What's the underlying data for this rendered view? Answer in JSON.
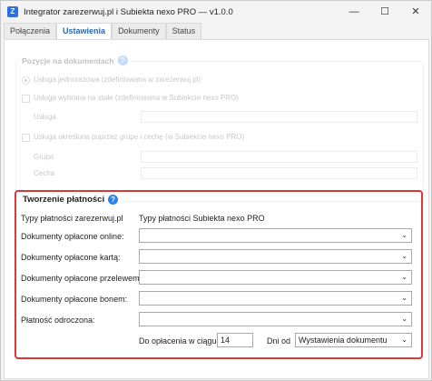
{
  "window": {
    "title": "Integrator zarezerwuj.pl i Subiekta nexo PRO — v1.0.0",
    "app_icon_letter": "Z",
    "controls": {
      "minimize": "—",
      "maximize": "☐",
      "close": "✕"
    }
  },
  "tabs": [
    {
      "label": "Połączenia",
      "active": false
    },
    {
      "label": "Ustawienia",
      "active": true
    },
    {
      "label": "Dokumenty",
      "active": false
    },
    {
      "label": "Status",
      "active": false
    }
  ],
  "positions_section": {
    "title": "Pozycje na dokumentach",
    "options": [
      "Usługa jednorazowa (zdefiniowana w zarezerwuj.pl)",
      "Usługa wybrana na stałe (zdefiniowana w Subiekcie nexo PRO)",
      "Usługa określona poprzez grupę i cechę (w Subiekcie nexo PRO)"
    ],
    "usluga_label": "Usługa",
    "grupa_label": "Grupa",
    "cecha_label": "Cecha"
  },
  "payments_section": {
    "title": "Tworzenie płatności",
    "col_left_header": "Typy płatności zarezerwuj.pl",
    "col_right_header": "Typy płatności Subiekta nexo PRO",
    "rows": [
      {
        "label": "Dokumenty opłacone online:",
        "value": ""
      },
      {
        "label": "Dokumenty opłacone kartą:",
        "value": ""
      },
      {
        "label": "Dokumenty opłacone przelewem:",
        "value": ""
      },
      {
        "label": "Dokumenty opłacone bonem:",
        "value": ""
      },
      {
        "label": "Płatność odroczona:",
        "value": ""
      }
    ],
    "due_label": "Do opłacenia w ciągu:",
    "due_value": "14",
    "days_from_label": "Dni od",
    "days_from_value": "Wystawienia dokumentu"
  },
  "colors": {
    "accent": "#2a66b0",
    "highlight_frame": "#d83a3a",
    "info": "#2f80ed"
  }
}
